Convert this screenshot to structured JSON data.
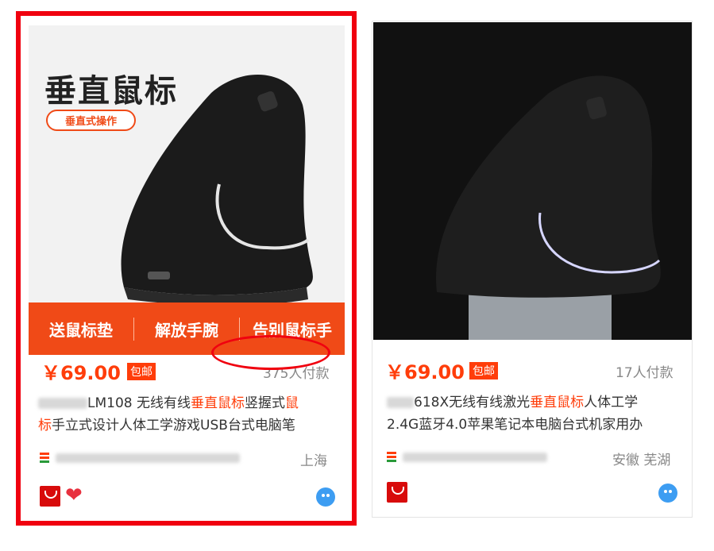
{
  "card1": {
    "image_headline": "垂直鼠标",
    "image_tag": "垂直式操作",
    "promo": [
      "送鼠标垫",
      "解放手腕",
      "告别鼠标手"
    ],
    "price": "￥69.00",
    "free_shipping": "包邮",
    "sales": "375人付款",
    "title_parts": {
      "p1": "LM108 无线有线",
      "hl1": "垂直鼠标",
      "p2": "竖握式",
      "hl2": "鼠",
      "hl3": "标",
      "p3": "手立式设计人体工学游戏USB台式电脑笔"
    },
    "location": "上海",
    "icons": [
      "tmall-icon",
      "heart-icon",
      "wangwang-icon"
    ],
    "highlight_color": "#f0000f"
  },
  "card2": {
    "price": "￥69.00",
    "free_shipping": "包邮",
    "sales": "17人付款",
    "title_parts": {
      "p1": "618X无线有线激光",
      "hl1": "垂直鼠标",
      "p2": "人体工学",
      "p3": "2.4G蓝牙4.0苹果笔记本电脑台式机家用办"
    },
    "location": "安徽 芜湖",
    "icons": [
      "tmall-icon",
      "wangwang-icon"
    ]
  },
  "colors": {
    "accent": "#ff3d0a",
    "promo_bar": "#f04a17"
  }
}
